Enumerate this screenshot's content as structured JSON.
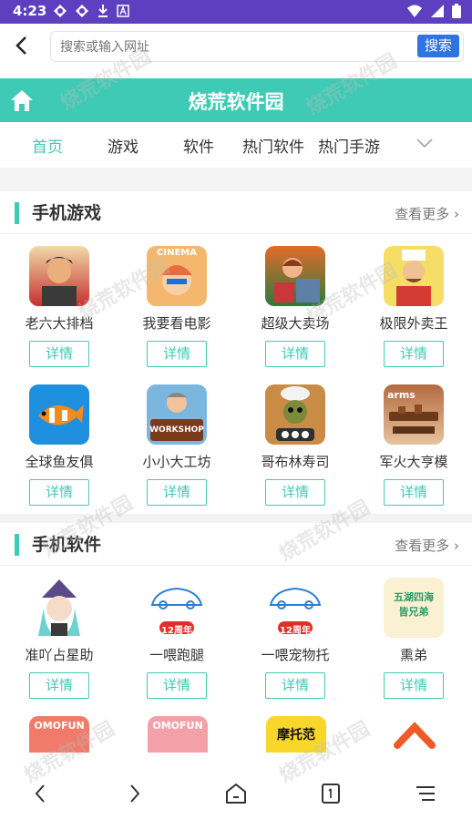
{
  "status_bar": {
    "time": "4:23"
  },
  "address_bar": {
    "placeholder": "搜索或输入网址",
    "search_label": "搜索"
  },
  "site": {
    "title": "烧荒软件园"
  },
  "nav": {
    "tabs": [
      "首页",
      "游戏",
      "软件",
      "热门软件",
      "热门手游"
    ],
    "active": "首页"
  },
  "sections": [
    {
      "title": "手机游戏",
      "more_label": "查看更多",
      "apps": [
        {
          "name": "老六大排档",
          "action": "详情"
        },
        {
          "name": "我要看电影",
          "action": "详情",
          "icon_text": "CINEMA"
        },
        {
          "name": "超级大卖场",
          "action": "详情"
        },
        {
          "name": "极限外卖王",
          "action": "详情"
        },
        {
          "name": "全球鱼友俱",
          "action": "详情"
        },
        {
          "name": "小小大工坊",
          "action": "详情",
          "icon_text": "WORKSHOP"
        },
        {
          "name": "哥布林寿司",
          "action": "详情"
        },
        {
          "name": "军火大亨模",
          "action": "详情",
          "icon_text": "arms"
        }
      ]
    },
    {
      "title": "手机软件",
      "more_label": "查看更多",
      "apps": [
        {
          "name": "准吖占星助",
          "action": "详情"
        },
        {
          "name": "一喂跑腿",
          "action": "详情",
          "icon_text": "12周年"
        },
        {
          "name": "一喂宠物托",
          "action": "详情",
          "icon_text": "12周年"
        },
        {
          "name": "熏弟",
          "action": "详情",
          "icon_text": "五湖四海 皆兄弟"
        }
      ]
    }
  ],
  "partial_icons": [
    {
      "icon_text": "OMOFUN"
    },
    {
      "icon_text": "OMOFUN"
    },
    {
      "icon_text": "摩托范"
    },
    {
      "icon_text": ""
    }
  ],
  "watermark": "烧荒软件园",
  "colors": {
    "accent": "#3fcab5",
    "status_bar": "#5d3fbf",
    "search_button": "#2f74e0"
  }
}
